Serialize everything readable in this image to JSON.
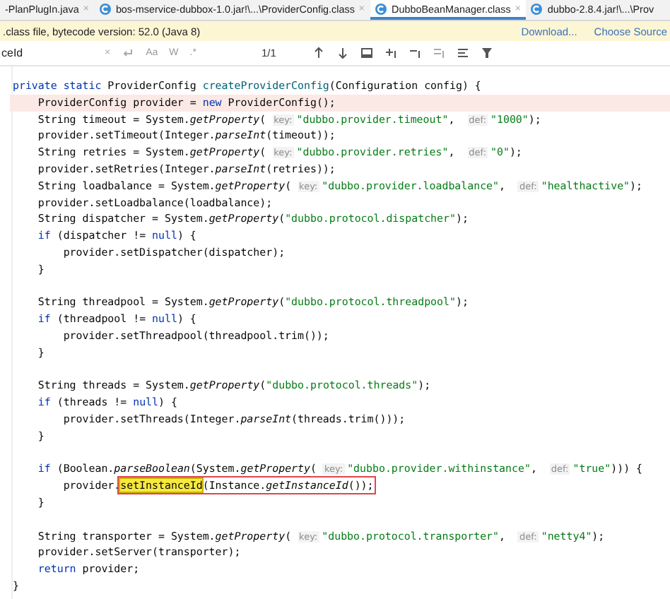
{
  "tabs": [
    {
      "label": "-PlanPlugIn.java",
      "icon": false,
      "selected": false,
      "close": "×"
    },
    {
      "label": "bos-mservice-dubbox-1.0.jar!\\...\\ProviderConfig.class",
      "icon": true,
      "selected": false,
      "close": "×"
    },
    {
      "label": "DubboBeanManager.class",
      "icon": true,
      "selected": true,
      "close": "×"
    },
    {
      "label": "dubbo-2.8.4.jar!\\...\\Prov",
      "icon": true,
      "selected": false
    }
  ],
  "banner": {
    "text": ".class file, bytecode version: 52.0 (Java 8)",
    "links": [
      "Download...",
      "Choose Source"
    ]
  },
  "search": {
    "value": "ceId",
    "clear": "×",
    "options": [
      "Aa",
      "W",
      ".*"
    ],
    "count": "1/1"
  },
  "code": {
    "lines": [
      {
        "tokens": [
          {
            "kind": "keyword",
            "text": "private static "
          },
          {
            "kind": "plain",
            "text": "ProviderConfig "
          },
          {
            "kind": "decl",
            "text": "createProviderConfig"
          },
          {
            "kind": "plain",
            "text": "(Configuration config) {"
          }
        ]
      },
      {
        "highlighted": true,
        "tokens": [
          {
            "kind": "plain",
            "text": "    ProviderConfig provider = "
          },
          {
            "kind": "keyword",
            "text": "new "
          },
          {
            "kind": "plain",
            "text": "ProviderConfig();"
          }
        ]
      },
      {
        "tokens": [
          {
            "kind": "plain",
            "text": "    String timeout = System."
          },
          {
            "kind": "italic",
            "text": "getProperty"
          },
          {
            "kind": "plain",
            "text": "( "
          },
          {
            "kind": "hint",
            "text": "key:"
          },
          {
            "kind": "string",
            "text": "\"dubbo.provider.timeout\""
          },
          {
            "kind": "plain",
            "text": ",  "
          },
          {
            "kind": "hint",
            "text": "def:"
          },
          {
            "kind": "string",
            "text": "\"1000\""
          },
          {
            "kind": "plain",
            "text": ");"
          }
        ]
      },
      {
        "tokens": [
          {
            "kind": "plain",
            "text": "    provider.setTimeout(Integer."
          },
          {
            "kind": "italic",
            "text": "parseInt"
          },
          {
            "kind": "plain",
            "text": "(timeout));"
          }
        ]
      },
      {
        "tokens": [
          {
            "kind": "plain",
            "text": "    String retries = System."
          },
          {
            "kind": "italic",
            "text": "getProperty"
          },
          {
            "kind": "plain",
            "text": "( "
          },
          {
            "kind": "hint",
            "text": "key:"
          },
          {
            "kind": "string",
            "text": "\"dubbo.provider.retries\""
          },
          {
            "kind": "plain",
            "text": ",  "
          },
          {
            "kind": "hint",
            "text": "def:"
          },
          {
            "kind": "string",
            "text": "\"0\""
          },
          {
            "kind": "plain",
            "text": ");"
          }
        ]
      },
      {
        "tokens": [
          {
            "kind": "plain",
            "text": "    provider.setRetries(Integer."
          },
          {
            "kind": "italic",
            "text": "parseInt"
          },
          {
            "kind": "plain",
            "text": "(retries));"
          }
        ]
      },
      {
        "tokens": [
          {
            "kind": "plain",
            "text": "    String loadbalance = System."
          },
          {
            "kind": "italic",
            "text": "getProperty"
          },
          {
            "kind": "plain",
            "text": "( "
          },
          {
            "kind": "hint",
            "text": "key:"
          },
          {
            "kind": "string",
            "text": "\"dubbo.provider.loadbalance\""
          },
          {
            "kind": "plain",
            "text": ",  "
          },
          {
            "kind": "hint",
            "text": "def:"
          },
          {
            "kind": "string",
            "text": "\"healthactive\""
          },
          {
            "kind": "plain",
            "text": ");"
          }
        ]
      },
      {
        "tokens": [
          {
            "kind": "plain",
            "text": "    provider.setLoadbalance(loadbalance);"
          }
        ]
      },
      {
        "tokens": [
          {
            "kind": "plain",
            "text": "    String dispatcher = System."
          },
          {
            "kind": "italic",
            "text": "getProperty"
          },
          {
            "kind": "plain",
            "text": "("
          },
          {
            "kind": "string",
            "text": "\"dubbo.protocol.dispatcher\""
          },
          {
            "kind": "plain",
            "text": ");"
          }
        ]
      },
      {
        "tokens": [
          {
            "kind": "keyword",
            "text": "    if "
          },
          {
            "kind": "plain",
            "text": "(dispatcher != "
          },
          {
            "kind": "keyword",
            "text": "null"
          },
          {
            "kind": "plain",
            "text": ") {"
          }
        ]
      },
      {
        "tokens": [
          {
            "kind": "plain",
            "text": "        provider.setDispatcher(dispatcher);"
          }
        ]
      },
      {
        "tokens": [
          {
            "kind": "plain",
            "text": "    }"
          }
        ]
      },
      {
        "gap_before": true,
        "tokens": [
          {
            "kind": "plain",
            "text": "    String threadpool = System."
          },
          {
            "kind": "italic",
            "text": "getProperty"
          },
          {
            "kind": "plain",
            "text": "("
          },
          {
            "kind": "string",
            "text": "\"dubbo.protocol.threadpool\""
          },
          {
            "kind": "plain",
            "text": ");"
          }
        ]
      },
      {
        "tokens": [
          {
            "kind": "keyword",
            "text": "    if "
          },
          {
            "kind": "plain",
            "text": "(threadpool != "
          },
          {
            "kind": "keyword",
            "text": "null"
          },
          {
            "kind": "plain",
            "text": ") {"
          }
        ]
      },
      {
        "tokens": [
          {
            "kind": "plain",
            "text": "        provider.setThreadpool(threadpool.trim());"
          }
        ]
      },
      {
        "tokens": [
          {
            "kind": "plain",
            "text": "    }"
          }
        ]
      },
      {
        "gap_before": true,
        "tokens": [
          {
            "kind": "plain",
            "text": "    String threads = System."
          },
          {
            "kind": "italic",
            "text": "getProperty"
          },
          {
            "kind": "plain",
            "text": "("
          },
          {
            "kind": "string",
            "text": "\"dubbo.protocol.threads\""
          },
          {
            "kind": "plain",
            "text": ");"
          }
        ]
      },
      {
        "tokens": [
          {
            "kind": "keyword",
            "text": "    if "
          },
          {
            "kind": "plain",
            "text": "(threads != "
          },
          {
            "kind": "keyword",
            "text": "null"
          },
          {
            "kind": "plain",
            "text": ") {"
          }
        ]
      },
      {
        "tokens": [
          {
            "kind": "plain",
            "text": "        provider.setThreads(Integer."
          },
          {
            "kind": "italic",
            "text": "parseInt"
          },
          {
            "kind": "plain",
            "text": "(threads.trim()));"
          }
        ]
      },
      {
        "tokens": [
          {
            "kind": "plain",
            "text": "    }"
          }
        ]
      },
      {
        "gap_before": true,
        "tokens": [
          {
            "kind": "keyword",
            "text": "    if "
          },
          {
            "kind": "plain",
            "text": "(Boolean."
          },
          {
            "kind": "italic",
            "text": "parseBoolean"
          },
          {
            "kind": "plain",
            "text": "(System."
          },
          {
            "kind": "italic",
            "text": "getProperty"
          },
          {
            "kind": "plain",
            "text": "( "
          },
          {
            "kind": "hint",
            "text": "key:"
          },
          {
            "kind": "string",
            "text": "\"dubbo.provider.withinstance\""
          },
          {
            "kind": "plain",
            "text": ",  "
          },
          {
            "kind": "hint",
            "text": "def:"
          },
          {
            "kind": "string",
            "text": "\"true\""
          },
          {
            "kind": "plain",
            "text": "))) {"
          }
        ]
      },
      {
        "boxed": true,
        "tokens": [
          {
            "kind": "plain",
            "text": "        provider."
          },
          {
            "kind": "match",
            "text": "setInstanceId"
          },
          {
            "kind": "plain",
            "text": "(Instance."
          },
          {
            "kind": "italic",
            "text": "getInstanceId"
          },
          {
            "kind": "plain",
            "text": "());"
          }
        ]
      },
      {
        "tokens": [
          {
            "kind": "plain",
            "text": "    }"
          }
        ]
      },
      {
        "gap_before": true,
        "tokens": [
          {
            "kind": "plain",
            "text": "    String transporter = System."
          },
          {
            "kind": "italic",
            "text": "getProperty"
          },
          {
            "kind": "plain",
            "text": "( "
          },
          {
            "kind": "hint",
            "text": "key:"
          },
          {
            "kind": "string",
            "text": "\"dubbo.protocol.transporter\""
          },
          {
            "kind": "plain",
            "text": ",  "
          },
          {
            "kind": "hint",
            "text": "def:"
          },
          {
            "kind": "string",
            "text": "\"netty4\""
          },
          {
            "kind": "plain",
            "text": ");"
          }
        ]
      },
      {
        "tokens": [
          {
            "kind": "plain",
            "text": "    provider.setServer(transporter);"
          }
        ]
      },
      {
        "tokens": [
          {
            "kind": "keyword",
            "text": "    return "
          },
          {
            "kind": "plain",
            "text": "provider;"
          }
        ]
      },
      {
        "tokens": [
          {
            "kind": "plain",
            "text": "}"
          }
        ]
      }
    ]
  }
}
